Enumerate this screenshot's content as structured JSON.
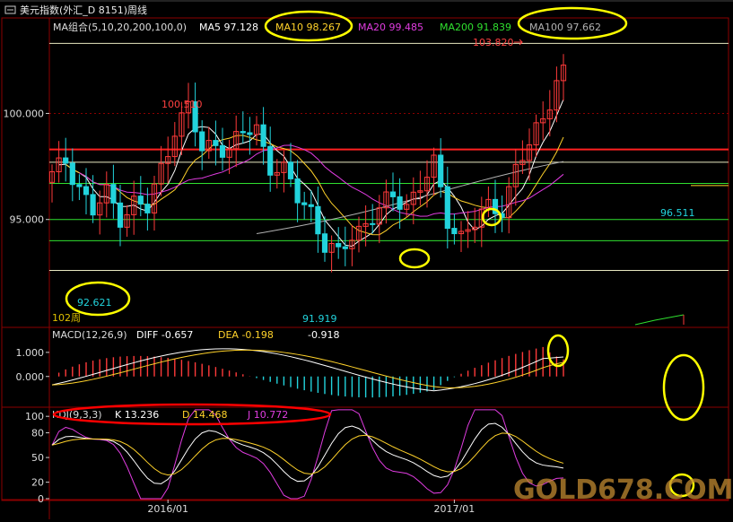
{
  "title": "美元指数(外汇_D 8151)周线",
  "colors": {
    "bg": "#000000",
    "frame": "#8b0000",
    "up": "#ff3a3a",
    "down": "#22d3dc",
    "ma5": "#ffffff",
    "ma10": "#ffd22a",
    "ma20": "#e03ce0",
    "ma200": "#2fe02f",
    "ma100": "#b0b0b0",
    "annot": "#ffff00",
    "redline": "#ff0000"
  },
  "ma_legend": {
    "group": "MA组合(5,10,20,200,100,0)",
    "ma5": "MA5 97.128",
    "ma10": "MA10 98.267",
    "ma20": "MA20 99.485",
    "ma200": "MA200 91.839",
    "ma100": "MA100 97.662"
  },
  "price_labels": {
    "high_2016": "100.510",
    "high_2017": "103.820",
    "low_left": "92.621",
    "low_mid": "91.919",
    "last": "96.511",
    "period_tag": "102周"
  },
  "macd_legend": {
    "name": "MACD(12,26,9)",
    "diff": "DIFF  -0.657",
    "dea": "DEA  -0.198",
    "macd": "-0.918"
  },
  "kdj_legend": {
    "name": "KDJ(9,3,3)",
    "k": "K   13.236",
    "d": "D   14.468",
    "j": "J   10.772"
  },
  "watermark": "GOLD678.COM",
  "chart_data": [
    {
      "type": "candlestick",
      "name": "price",
      "y_ticks": [
        "100.000",
        "95.000"
      ],
      "ylim": [
        90.0,
        104.5
      ],
      "x_ticks": [
        "2016/01",
        "2017/01"
      ],
      "x_tick_index": [
        17,
        59
      ],
      "horizontal_levels": [
        103.3,
        100.0,
        98.3,
        97.7,
        96.7,
        95.0,
        94.0,
        92.6
      ],
      "n": 76,
      "anchors_close": [
        [
          0,
          97.0
        ],
        [
          2,
          97.8
        ],
        [
          4,
          96.6
        ],
        [
          6,
          95.3
        ],
        [
          8,
          96.2
        ],
        [
          10,
          95.2
        ],
        [
          12,
          95.8
        ],
        [
          14,
          95.4
        ],
        [
          16,
          97.4
        ],
        [
          18,
          99.4
        ],
        [
          20,
          100.2
        ],
        [
          22,
          98.2
        ],
        [
          24,
          98.7
        ],
        [
          26,
          98.3
        ],
        [
          28,
          99.0
        ],
        [
          30,
          99.3
        ],
        [
          32,
          97.6
        ],
        [
          34,
          97.2
        ],
        [
          36,
          96.0
        ],
        [
          38,
          95.5
        ],
        [
          40,
          93.8
        ],
        [
          42,
          93.2
        ],
        [
          44,
          94.3
        ],
        [
          46,
          94.9
        ],
        [
          48,
          95.4
        ],
        [
          50,
          96.0
        ],
        [
          52,
          95.8
        ],
        [
          54,
          96.6
        ],
        [
          56,
          97.5
        ],
        [
          58,
          95.0
        ],
        [
          60,
          94.3
        ],
        [
          62,
          94.8
        ],
        [
          64,
          95.5
        ],
        [
          66,
          95.6
        ],
        [
          68,
          97.4
        ],
        [
          70,
          98.4
        ],
        [
          72,
          99.8
        ],
        [
          74,
          101.7
        ],
        [
          76,
          102.2
        ],
        [
          78,
          102.2
        ],
        [
          80,
          102.6
        ],
        [
          82,
          101.0
        ],
        [
          84,
          100.3
        ],
        [
          86,
          100.6
        ],
        [
          88,
          101.1
        ],
        [
          90,
          100.9
        ],
        [
          92,
          99.4
        ],
        [
          94,
          98.1
        ],
        [
          96,
          97.4
        ],
        [
          99,
          97.2
        ],
        [
          100,
          96.5
        ]
      ],
      "ma_series": [
        "MA5",
        "MA10",
        "MA20",
        "MA100"
      ]
    },
    {
      "type": "bar",
      "name": "macd",
      "y_ticks": [
        "1.000",
        "0.000"
      ],
      "ylim": [
        -1.2,
        2.0
      ],
      "series": [
        "DIFF",
        "DEA",
        "MACD"
      ]
    },
    {
      "type": "line",
      "name": "kdj",
      "y_ticks": [
        "100",
        "80",
        "50",
        "20",
        "0"
      ],
      "ylim": [
        0,
        110
      ],
      "series": [
        "K",
        "D",
        "J"
      ]
    }
  ]
}
